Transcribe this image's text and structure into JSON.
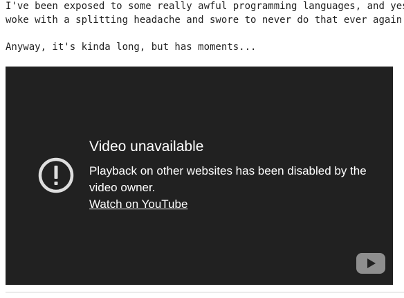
{
  "post": {
    "paragraph_1": {
      "line_1": "I've been exposed to some really awful programming languages, and yes, did do s",
      "line_2": "woke with a splitting headache and swore to never do that ever again."
    },
    "paragraph_2": "Anyway, it's kinda long, but has moments..."
  },
  "video": {
    "title": "Video unavailable",
    "message": "Playback on other websites has been disabled by the video owner.",
    "link": "Watch on YouTube",
    "icons": {
      "warning": "warning-circle-icon",
      "logo": "youtube-logo-icon"
    }
  },
  "colors": {
    "text": "#222222",
    "video_bg": "#212121",
    "video_text": "#ffffff",
    "logo_grey": "#8e8e8e"
  }
}
